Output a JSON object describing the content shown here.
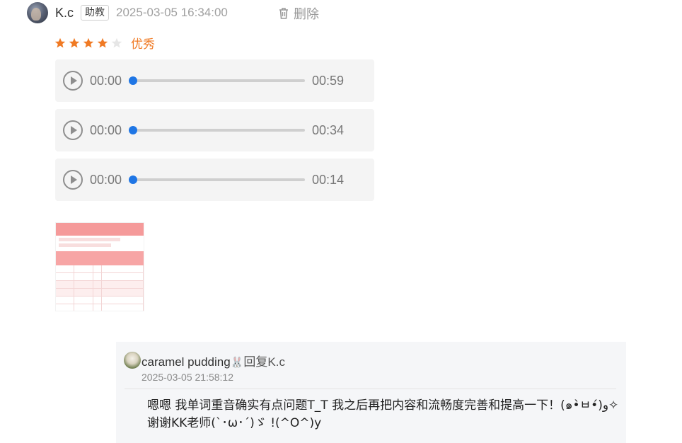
{
  "comment": {
    "username": "K.c",
    "badge": "助教",
    "timestamp": "2025-03-05 16:34:00",
    "delete_label": "删除",
    "rating": {
      "value": 4,
      "max": 5,
      "label": "优秀",
      "active_color": "#f07a24",
      "inactive_color": "#e6e6e6"
    },
    "audios": [
      {
        "current": "00:00",
        "total": "00:59",
        "progress": 0
      },
      {
        "current": "00:00",
        "total": "00:34",
        "progress": 0
      },
      {
        "current": "00:00",
        "total": "00:14",
        "progress": 0
      }
    ],
    "attachment_icon": "scoresheet-image-thumbnail"
  },
  "reply": {
    "username": "caramel pudding",
    "user_emoji": "🐰",
    "reply_to": "回复K.c",
    "timestamp": "2025-03-05 21:58:12",
    "text_line1": "嗯嗯 我单词重音确实有点问题T_T 我之后再把内容和流畅度完善和提高一下！(๑•̀ㅂ•́)و✧",
    "text_line2": "谢谢KK老师(`･ω･´)ゞ !(^O^)y"
  },
  "colors": {
    "accent": "#1f76e5",
    "rating": "#f07a24"
  }
}
